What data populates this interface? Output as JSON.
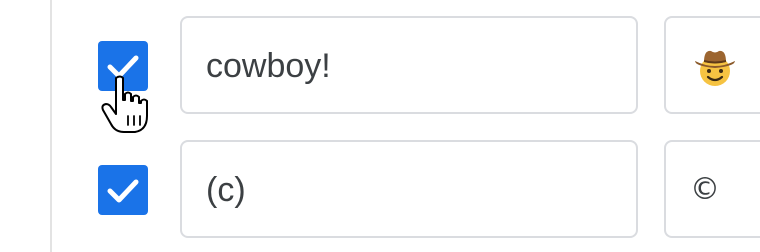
{
  "rows": [
    {
      "checked": true,
      "text_value": "cowboy!",
      "preview": {
        "icon": "cowboy-hat-face-icon"
      }
    },
    {
      "checked": true,
      "text_value": "(c)",
      "preview": {
        "text": "©"
      }
    }
  ],
  "colors": {
    "checkbox_fill": "#1a73e8",
    "field_border": "#dadce0",
    "text": "#3c4043",
    "divider": "#e3e3e3"
  },
  "pointer": {
    "icon": "hand-pointer-cursor-icon"
  }
}
